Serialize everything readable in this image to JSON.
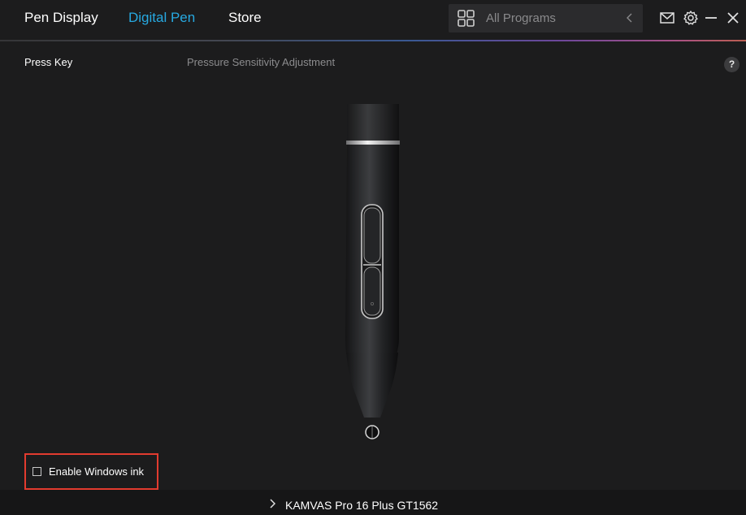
{
  "header": {
    "tabs": [
      {
        "label": "Pen Display",
        "active": false
      },
      {
        "label": "Digital Pen",
        "active": true
      },
      {
        "label": "Store",
        "active": false
      }
    ],
    "program_selector": {
      "label": "All Programs",
      "icon": "grid-icon"
    },
    "window_controls": [
      "mail-icon",
      "gear-icon",
      "minimize-icon",
      "close-icon"
    ],
    "accent_color": "#27a9e1"
  },
  "subtabs": [
    {
      "label": "Press Key",
      "active": true
    },
    {
      "label": "Pressure Sensitivity Adjustment",
      "active": false
    }
  ],
  "help": {
    "label": "?"
  },
  "windows_ink": {
    "label": "Enable Windows ink",
    "checked": false,
    "highlight_color": "#e23b2f"
  },
  "footer": {
    "device_name": "KAMVAS Pro 16 Plus GT1562"
  }
}
